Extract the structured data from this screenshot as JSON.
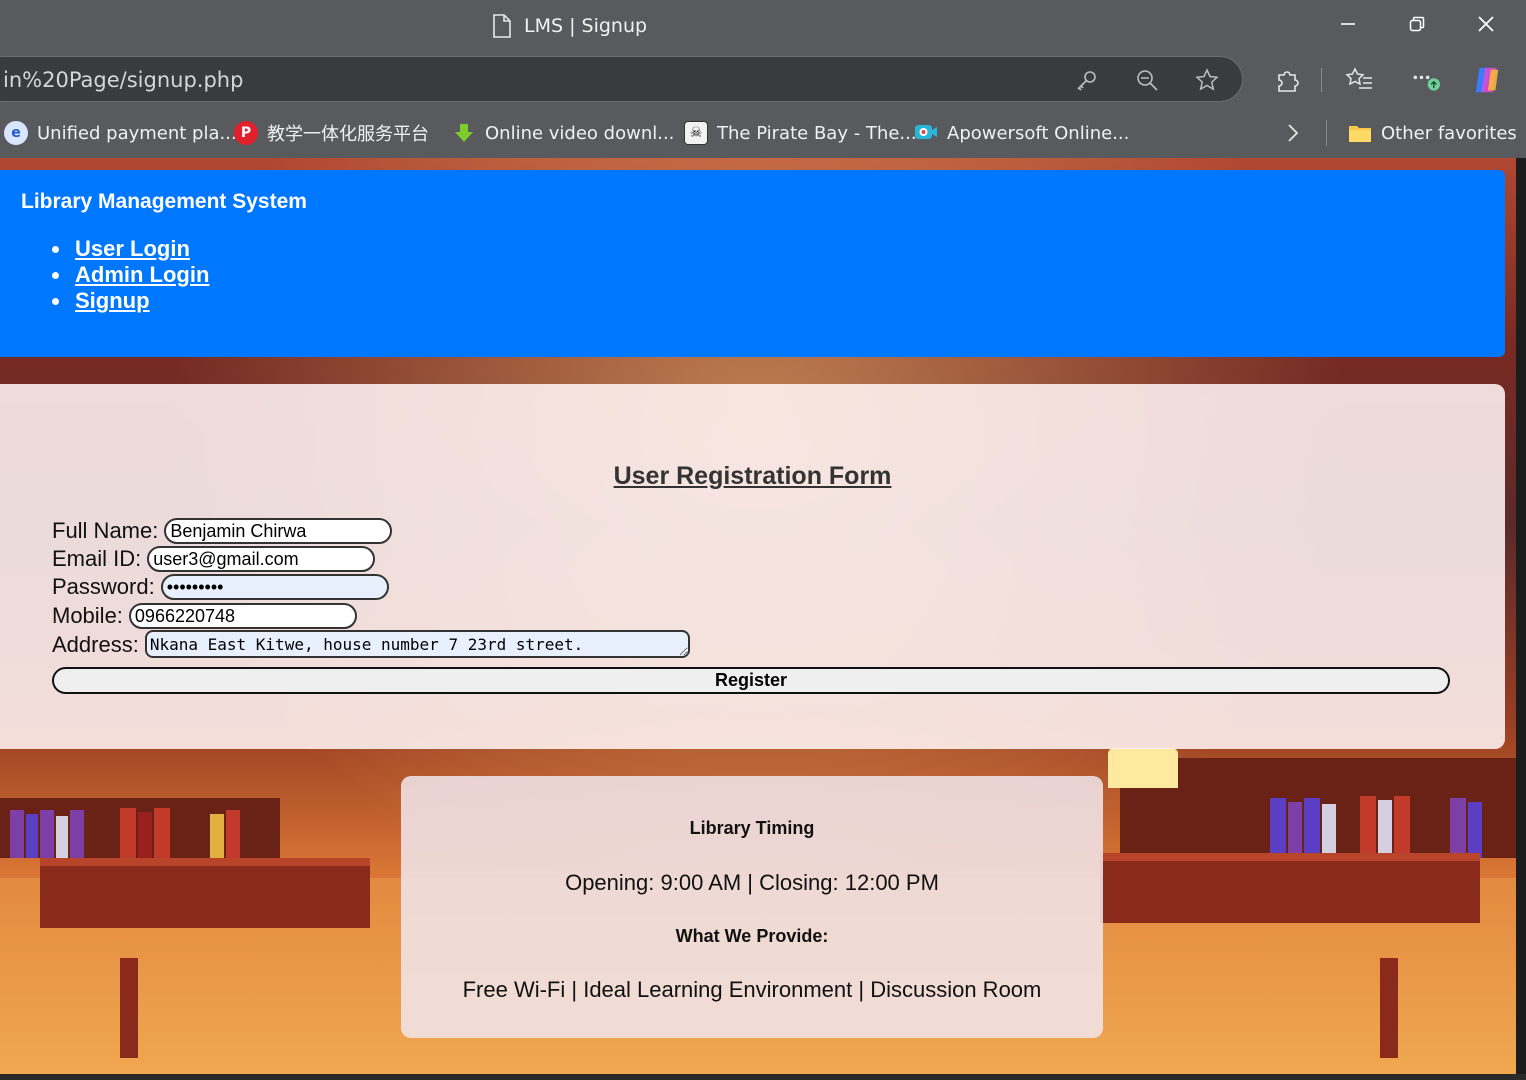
{
  "browser": {
    "window_title": "LMS | Signup",
    "url": "in%20Page/signup.php",
    "favorites": [
      {
        "label": "Unified payment pla...",
        "icon": "edge-e-icon"
      },
      {
        "label": "教学一体化服务平台",
        "icon": "p-logo-icon"
      },
      {
        "label": "Online video downl...",
        "icon": "download-arrow-icon"
      },
      {
        "label": "The Pirate Bay - The...",
        "icon": "pirate-ship-icon"
      },
      {
        "label": "Apowersoft Online...",
        "icon": "apowersoft-icon"
      }
    ],
    "other_favorites": "Other favorites"
  },
  "site": {
    "title": "Library Management System",
    "nav": [
      "User Login",
      "Admin Login",
      "Signup"
    ]
  },
  "form": {
    "title": "User Registration Form",
    "fields": {
      "full_name": {
        "label": "Full Name:",
        "value": "Benjamin Chirwa"
      },
      "email": {
        "label": "Email ID:",
        "value": "user3@gmail.com"
      },
      "password": {
        "label": "Password:",
        "value": "•••••••••"
      },
      "mobile": {
        "label": "Mobile:",
        "value": "0966220748"
      },
      "address": {
        "label": "Address:",
        "value": "Nkana East Kitwe, house number 7 23rd street."
      }
    },
    "submit_label": "Register"
  },
  "info": {
    "timing_heading": "Library Timing",
    "timing_text": "Opening: 9:00 AM | Closing: 12:00 PM",
    "provide_heading": "What We Provide:",
    "provide_text": "Free Wi-Fi | Ideal Learning Environment | Discussion Room"
  },
  "colors": {
    "header_blue": "#0077ff",
    "chrome_gray": "#595a5e",
    "autofill_blue": "#e8f0fe"
  }
}
